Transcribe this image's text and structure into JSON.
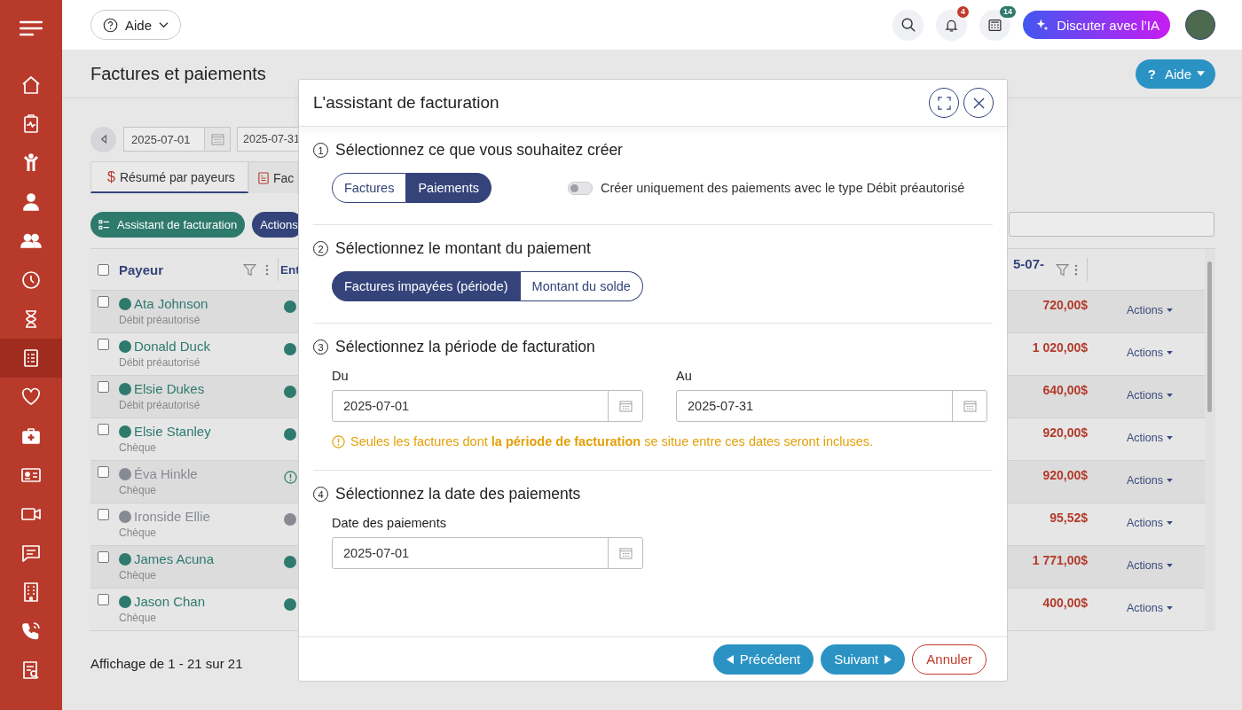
{
  "sidebar": {
    "items": [
      {
        "selected": false
      },
      {
        "selected": false
      },
      {
        "selected": false
      },
      {
        "selected": false
      },
      {
        "selected": false
      },
      {
        "selected": false
      },
      {
        "selected": false
      },
      {
        "selected": true
      },
      {
        "selected": false
      },
      {
        "selected": false
      },
      {
        "selected": false
      },
      {
        "selected": false
      },
      {
        "selected": false
      },
      {
        "selected": false
      },
      {
        "selected": false
      },
      {
        "selected": false
      }
    ]
  },
  "topbar": {
    "help": "Aide",
    "notifications_badge": "4",
    "calculator_badge": "14",
    "ai_button": "Discuter avec l’IA"
  },
  "page": {
    "title": "Factures et paiements",
    "help_button": "Aide",
    "help_icon": "?",
    "date_from": "2025-07-01",
    "date_to": "2025-07-31",
    "tabs": [
      {
        "label": "Résumé par payeurs",
        "icon": "$",
        "selected": true
      },
      {
        "label": "Fac",
        "selected": false
      }
    ],
    "buttons": [
      {
        "label": "Assistant de facturation",
        "kind": "wizard"
      },
      {
        "label": "Actions",
        "kind": "actions"
      }
    ],
    "table": {
      "columns": [
        "Payeur",
        "Ent",
        "5-07-"
      ],
      "select_all_checked": false,
      "rows": [
        {
          "name": "Ata Johnson",
          "subtitle": "Débit préautorisé",
          "color": "#2e7a6c",
          "kind": "dot",
          "amount": "720,00$",
          "action": "Actions",
          "checked": false
        },
        {
          "name": "Donald Duck",
          "subtitle": "Débit préautorisé",
          "color": "#2e7a6c",
          "kind": "dot",
          "amount": "1 020,00$",
          "action": "Actions",
          "checked": false
        },
        {
          "name": "Elsie Dukes",
          "subtitle": "Débit préautorisé",
          "color": "#2e7a6c",
          "kind": "dot",
          "amount": "640,00$",
          "action": "Actions",
          "checked": false
        },
        {
          "name": "Elsie Stanley",
          "subtitle": "Chèque",
          "color": "#2e7a6c",
          "kind": "dot",
          "amount": "920,00$",
          "action": "Actions",
          "checked": false
        },
        {
          "name": "Éva Hinkle",
          "subtitle": "Chèque",
          "color": "#878a93",
          "kind": "warning",
          "amount": "920,00$",
          "action": "Actions",
          "checked": false
        },
        {
          "name": "Ironside Ellie",
          "subtitle": "Chèque",
          "color": "#878a93",
          "kind": "dot",
          "amount": "95,52$",
          "action": "Actions",
          "checked": false
        },
        {
          "name": "James Acuna",
          "subtitle": "Chèque",
          "color": "#2e7a6c",
          "kind": "dot",
          "amount": "1 771,00$",
          "action": "Actions",
          "checked": false
        },
        {
          "name": "Jason Chan",
          "subtitle": "Chèque",
          "color": "#2e7a6c",
          "kind": "dot",
          "amount": "400,00$",
          "action": "Actions",
          "checked": false
        }
      ]
    },
    "footer": "Affichage de 1 - 21 sur 21"
  },
  "wizard": {
    "title": "L'assistant de facturation",
    "steps": [
      {
        "number": "1",
        "title": "Sélectionnez ce que vous souhaitez créer",
        "kind": "choice",
        "options": [
          {
            "label": "Factures",
            "selected": false
          },
          {
            "label": "Paiements",
            "selected": true
          }
        ],
        "toggle": {
          "label": "Créer uniquement des paiements avec le type Débit préautorisé",
          "on": false
        }
      },
      {
        "number": "2",
        "title": "Sélectionnez le montant du paiement",
        "kind": "choice",
        "options": [
          {
            "label": "Factures impayées (période)",
            "selected": true
          },
          {
            "label": "Montant du solde",
            "selected": false
          }
        ]
      },
      {
        "number": "3",
        "title": "Sélectionnez la période de facturation",
        "kind": "period",
        "fields": [
          {
            "label": "Du",
            "value": "2025-07-01"
          },
          {
            "label": "Au",
            "value": "2025-07-31"
          }
        ],
        "note": "Seules les factures dont **la période de facturation** se situe entre ces dates seront incluses."
      },
      {
        "number": "4",
        "title": "Sélectionnez la date des paiements",
        "kind": "date",
        "fields": [
          {
            "label": "Date des paiements",
            "value": "2025-07-01"
          }
        ]
      }
    ],
    "buttons": [
      {
        "label": "Précédent",
        "kind": "back"
      },
      {
        "label": "Suivant",
        "kind": "next"
      },
      {
        "label": "Annuler",
        "kind": "cancel"
      }
    ]
  }
}
